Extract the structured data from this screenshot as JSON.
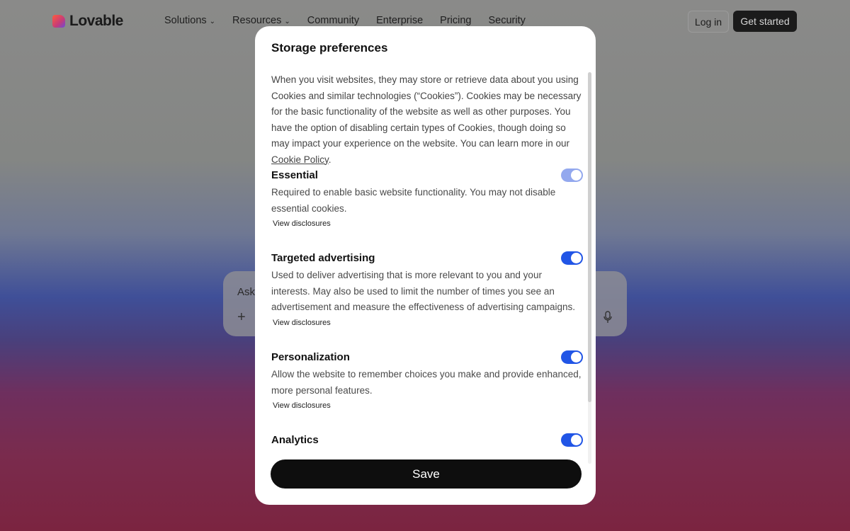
{
  "brand": {
    "name": "Lovable"
  },
  "nav": {
    "items": [
      {
        "label": "Solutions",
        "has_menu": true
      },
      {
        "label": "Resources",
        "has_menu": true
      },
      {
        "label": "Community",
        "has_menu": false
      },
      {
        "label": "Enterprise",
        "has_menu": false
      },
      {
        "label": "Pricing",
        "has_menu": false
      },
      {
        "label": "Security",
        "has_menu": false
      }
    ],
    "login_label": "Log in",
    "get_started_label": "Get started"
  },
  "prompt": {
    "placeholder": "Ask"
  },
  "modal": {
    "title": "Storage preferences",
    "intro": "When you visit websites, they may store or retrieve data about you using Cookies and similar technologies (“Cookies”). Cookies may be necessary for the basic functionality of the website as well as other purposes. You have the option of disabling certain types of Cookies, though doing so may impact your experience on the website. You can learn more in our ",
    "intro_link": "Cookie Policy",
    "intro_end": ".",
    "sections": [
      {
        "title": "Essential",
        "description": "Required to enable basic website functionality. You may not disable essential cookies.",
        "disclosures_label": "View disclosures",
        "enabled": true,
        "locked": true
      },
      {
        "title": "Targeted advertising",
        "description": "Used to deliver advertising that is more relevant to you and your interests. May also be used to limit the number of times you see an advertisement and measure the effectiveness of advertising campaigns.",
        "disclosures_label": "View disclosures",
        "enabled": true,
        "locked": false
      },
      {
        "title": "Personalization",
        "description": "Allow the website to remember choices you make and provide enhanced, more personal features.",
        "disclosures_label": "View disclosures",
        "enabled": true,
        "locked": false
      },
      {
        "title": "Analytics",
        "enabled": true,
        "locked": false
      }
    ],
    "save_label": "Save"
  },
  "colors": {
    "toggle_on": "#2155e6",
    "toggle_locked": "#93a8ee",
    "save_bg": "#0e0e0e"
  }
}
